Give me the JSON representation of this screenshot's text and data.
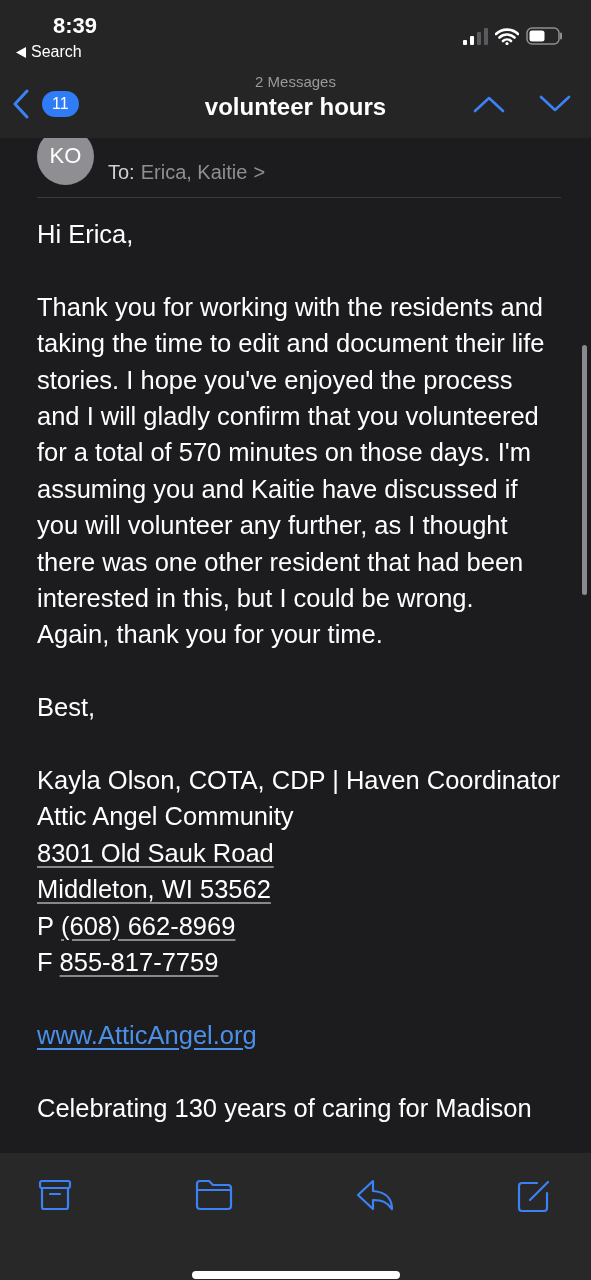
{
  "status_bar": {
    "time": "8:39",
    "back_label": "Search"
  },
  "nav": {
    "subtitle": "2 Messages",
    "title": "volunteer hours",
    "badge": "11"
  },
  "message": {
    "avatar": "KO",
    "to_label": "To:",
    "recipients": "Erica, Kaitie",
    "chevron": ">"
  },
  "body": [
    [
      {
        "parts": [
          {
            "text": "Hi Erica,",
            "kind": "plain"
          }
        ]
      }
    ],
    [
      {
        "parts": [
          {
            "text": "Thank you for working with the residents and taking the time to edit and document their life stories. I hope you've enjoyed the process and I will gladly confirm that you volunteered for a total of 570 minutes on those days. I'm assuming you and Kaitie have discussed if you will volunteer any further, as I thought there was one other resident that had been interested in this, but I could be wrong.",
            "kind": "plain"
          }
        ]
      },
      {
        "parts": [
          {
            "text": "Again, thank you for your time.",
            "kind": "plain"
          }
        ]
      }
    ],
    [
      {
        "parts": [
          {
            "text": "Best,",
            "kind": "plain"
          }
        ]
      }
    ],
    [
      {
        "parts": [
          {
            "text": "Kayla Olson, COTA, CDP | Haven Coordinator",
            "kind": "plain"
          }
        ]
      },
      {
        "parts": [
          {
            "text": "Attic Angel Community",
            "kind": "plain"
          }
        ]
      },
      {
        "parts": [
          {
            "text": "8301 Old Sauk Road",
            "kind": "detected"
          }
        ]
      },
      {
        "parts": [
          {
            "text": "Middleton, WI 53562",
            "kind": "detected"
          }
        ]
      },
      {
        "parts": [
          {
            "text": "P",
            "kind": "plain"
          },
          {
            "text": "(608) 662-8969",
            "kind": "detected"
          }
        ]
      },
      {
        "parts": [
          {
            "text": "F",
            "kind": "plain"
          },
          {
            "text": "855-817-7759",
            "kind": "detected"
          }
        ]
      }
    ],
    [
      {
        "parts": [
          {
            "text": "www.AtticAngel.org",
            "kind": "link"
          }
        ]
      }
    ],
    [
      {
        "parts": [
          {
            "text": "Celebrating 130 years of caring for Madison",
            "kind": "plain"
          }
        ]
      }
    ]
  ]
}
